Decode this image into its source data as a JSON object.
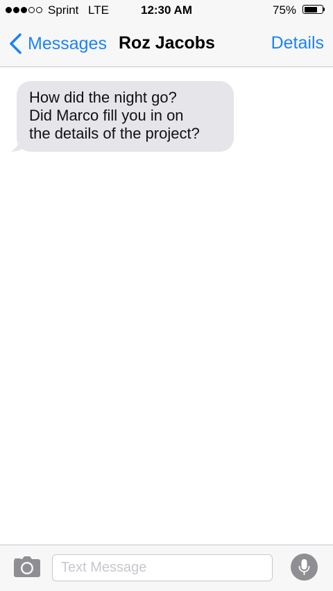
{
  "status_bar": {
    "signal_bars_filled": 3,
    "signal_bars_total": 5,
    "carrier": "Sprint",
    "network": "LTE",
    "time": "12:30 AM",
    "battery_percent_label": "75%",
    "battery_level": 0.75
  },
  "nav": {
    "back_label": "Messages",
    "title": "Roz Jacobs",
    "details_label": "Details"
  },
  "messages": [
    {
      "direction": "incoming",
      "text": "How did the night go?\nDid Marco fill you in on\nthe details of the project?"
    }
  ],
  "input_bar": {
    "placeholder": "Text Message",
    "value": "",
    "camera_icon": "camera-icon",
    "mic_icon": "microphone-icon"
  },
  "colors": {
    "accent": "#1a82fb",
    "incoming_bubble": "#e5e5ea",
    "bar_background": "#f7f7f7"
  }
}
